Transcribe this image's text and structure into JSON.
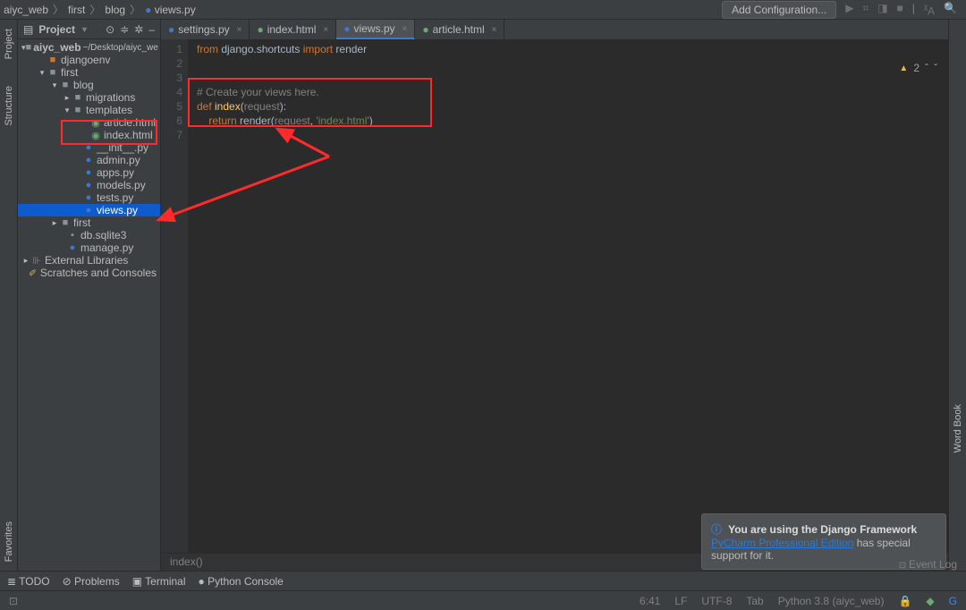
{
  "breadcrumb": [
    "aiyc_web",
    "first",
    "blog",
    "views.py"
  ],
  "cfg_button": "Add Configuration...",
  "sidebar": {
    "title": "Project",
    "root": "aiyc_web",
    "root_hint": "~/Desktop/aiyc_we",
    "items": [
      {
        "pad": 22,
        "ar": "",
        "ic": "folder",
        "lb": "djangoenv",
        "cl": "folder-ic",
        "col": "#cc7832"
      },
      {
        "pad": 22,
        "ar": "▾",
        "ic": "folder",
        "lb": "first",
        "cl": "folder-ic"
      },
      {
        "pad": 36,
        "ar": "▾",
        "ic": "folder",
        "lb": "blog",
        "cl": "folder-ic"
      },
      {
        "pad": 50,
        "ar": "▸",
        "ic": "folder",
        "lb": "migrations",
        "cl": "folder-ic"
      },
      {
        "pad": 50,
        "ar": "▾",
        "ic": "folder",
        "lb": "templates",
        "cl": "folder-ic"
      },
      {
        "pad": 70,
        "ar": "",
        "ic": "html",
        "lb": "article.html",
        "cl": "html-ic"
      },
      {
        "pad": 70,
        "ar": "",
        "ic": "html",
        "lb": "index.html",
        "cl": "html-ic"
      },
      {
        "pad": 62,
        "ar": "",
        "ic": "py",
        "lb": "__init__.py",
        "cl": "py-ic"
      },
      {
        "pad": 62,
        "ar": "",
        "ic": "py",
        "lb": "admin.py",
        "cl": "py-ic"
      },
      {
        "pad": 62,
        "ar": "",
        "ic": "py",
        "lb": "apps.py",
        "cl": "py-ic"
      },
      {
        "pad": 62,
        "ar": "",
        "ic": "py",
        "lb": "models.py",
        "cl": "py-ic"
      },
      {
        "pad": 62,
        "ar": "",
        "ic": "py",
        "lb": "tests.py",
        "cl": "py-ic"
      },
      {
        "pad": 62,
        "ar": "",
        "ic": "py",
        "lb": "views.py",
        "cl": "py-ic",
        "sel": true
      },
      {
        "pad": 36,
        "ar": "▸",
        "ic": "folder",
        "lb": "first",
        "cl": "folder-ic"
      },
      {
        "pad": 44,
        "ar": "",
        "ic": "db",
        "lb": "db.sqlite3",
        "cl": "folder-ic"
      },
      {
        "pad": 44,
        "ar": "",
        "ic": "py",
        "lb": "manage.py",
        "cl": "py-ic"
      }
    ],
    "ext_lib": "External Libraries",
    "scratch": "Scratches and Consoles"
  },
  "gutters": {
    "project": "Project",
    "structure": "Structure",
    "favorites": "Favorites",
    "wordbook": "Word Book"
  },
  "tabs": [
    {
      "ic": "py",
      "lb": "settings.py"
    },
    {
      "ic": "html",
      "lb": "index.html"
    },
    {
      "ic": "py",
      "lb": "views.py",
      "active": true
    },
    {
      "ic": "html",
      "lb": "article.html"
    }
  ],
  "code": {
    "lines": [
      "1",
      "2",
      "3",
      "4",
      "5",
      "6",
      "7"
    ],
    "l1_a": "from",
    "l1_b": " django.shortcuts ",
    "l1_c": "import",
    "l1_d": " render",
    "l4": "# Create your views here.",
    "l5_a": "def ",
    "l5_b": "index",
    "l5_c": "(",
    "l5_d": "request",
    "l5_e": "):",
    "l6_a": "    return ",
    "l6_b": "render",
    "l6_c": "(",
    "l6_d": "request",
    "l6_e": ", ",
    "l6_f": "'index.html'",
    "l6_g": ")",
    "crumb": "index()",
    "insp_count": "2"
  },
  "notification": {
    "title": "You are using the Django Framework",
    "link": "PyCharm Professional Edition",
    "rest": " has special support for it."
  },
  "bottom": {
    "todo": "TODO",
    "problems": "Problems",
    "terminal": "Terminal",
    "pyconsole": "Python Console",
    "evlog": "Event Log"
  },
  "status": {
    "pos": "6:41",
    "lf": "LF",
    "enc": "UTF-8",
    "tab": "Tab",
    "py": "Python 3.8 (aiyc_web)"
  }
}
